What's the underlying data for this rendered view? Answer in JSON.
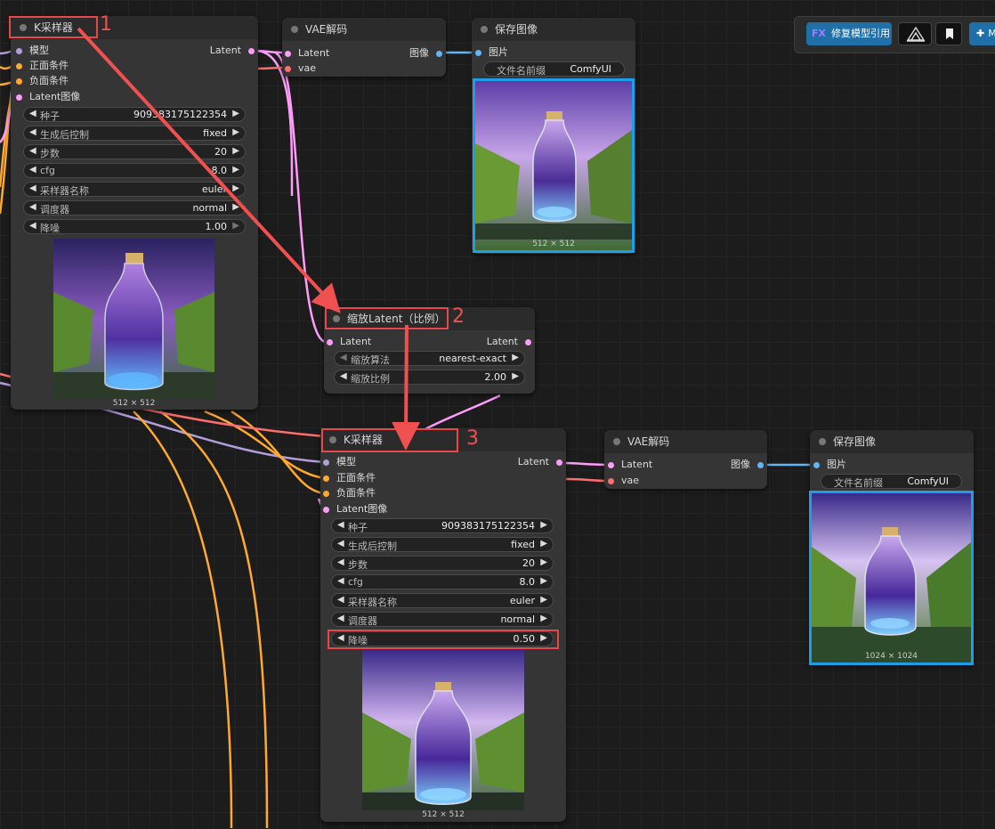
{
  "toolbar": {
    "fix_badge": "FX",
    "fix_label": "修复模型引用",
    "more_label": "M"
  },
  "ksampler1": {
    "title": "K采样器",
    "inputs": [
      "模型",
      "正面条件",
      "负面条件",
      "Latent图像"
    ],
    "output": "Latent",
    "widgets": [
      {
        "label": "种子",
        "value": "909383175122354"
      },
      {
        "label": "生成后控制",
        "value": "fixed"
      },
      {
        "label": "步数",
        "value": "20"
      },
      {
        "label": "cfg",
        "value": "8.0"
      },
      {
        "label": "采样器名称",
        "value": "euler"
      },
      {
        "label": "调度器",
        "value": "normal"
      },
      {
        "label": "降噪",
        "value": "1.00"
      }
    ],
    "size": "512 × 512"
  },
  "vae1": {
    "title": "VAE解码",
    "in_latent": "Latent",
    "in_vae": "vae",
    "out": "图像"
  },
  "save1": {
    "title": "保存图像",
    "in": "图片",
    "prefix_label": "文件名前缀",
    "prefix_value": "ComfyUI",
    "size": "512 × 512"
  },
  "upscale": {
    "title": "缩放Latent（比例）",
    "in": "Latent",
    "out": "Latent",
    "widgets": [
      {
        "label": "缩放算法",
        "value": "nearest-exact"
      },
      {
        "label": "缩放比例",
        "value": "2.00"
      }
    ]
  },
  "ksampler2": {
    "title": "K采样器",
    "inputs": [
      "模型",
      "正面条件",
      "负面条件",
      "Latent图像"
    ],
    "output": "Latent",
    "widgets": [
      {
        "label": "种子",
        "value": "909383175122354"
      },
      {
        "label": "生成后控制",
        "value": "fixed"
      },
      {
        "label": "步数",
        "value": "20"
      },
      {
        "label": "cfg",
        "value": "8.0"
      },
      {
        "label": "采样器名称",
        "value": "euler"
      },
      {
        "label": "调度器",
        "value": "normal"
      },
      {
        "label": "降噪",
        "value": "0.50"
      }
    ],
    "size": "512 × 512"
  },
  "vae2": {
    "title": "VAE解码",
    "in_latent": "Latent",
    "in_vae": "vae",
    "out": "图像"
  },
  "save2": {
    "title": "保存图像",
    "in": "图片",
    "prefix_label": "文件名前缀",
    "prefix_value": "ComfyUI",
    "size": "1024 × 1024"
  },
  "annotations": {
    "n1": "1",
    "n2": "2",
    "n3": "3"
  },
  "colors": {
    "model": "#b39ddb",
    "cond": "#ffa931",
    "latent": "#ff9cf9",
    "vae": "#ff6e6e",
    "image": "#64b5f6",
    "annotation_red": "#e8484a",
    "highlight_blue": "#1e9ee8"
  }
}
